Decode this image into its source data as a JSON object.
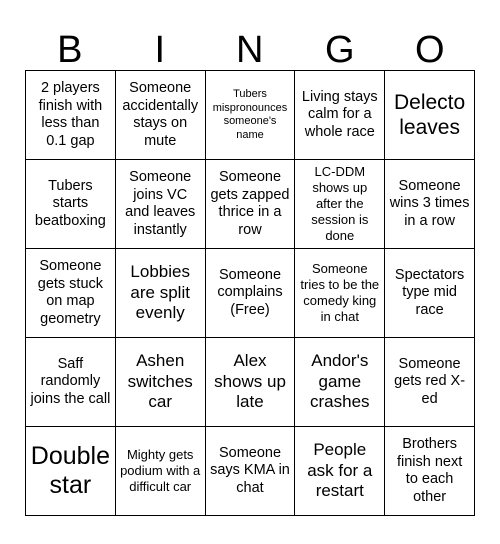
{
  "card": {
    "title": "BINGO",
    "header_letters": [
      "B",
      "I",
      "N",
      "G",
      "O"
    ],
    "grid_size": "5x5",
    "colors": {
      "background": "#ffffff",
      "text": "#000000",
      "border": "#000000"
    },
    "rows": [
      [
        {
          "text": "2 players finish with less than 0.1 gap",
          "size": "m",
          "marked": false
        },
        {
          "text": "Someone accidentally stays on mute",
          "size": "m",
          "marked": false
        },
        {
          "text": "Tubers mispronounces someone's name",
          "size": "xs",
          "marked": false
        },
        {
          "text": "Living stays calm for a whole race",
          "size": "m",
          "marked": false
        },
        {
          "text": "Delecto leaves",
          "size": "xl",
          "marked": false
        }
      ],
      [
        {
          "text": "Tubers starts beatboxing",
          "size": "m",
          "marked": false
        },
        {
          "text": "Someone joins VC and leaves instantly",
          "size": "m",
          "marked": false
        },
        {
          "text": "Someone gets zapped thrice in a row",
          "size": "m",
          "marked": false
        },
        {
          "text": "LC-DDM shows up after the session is done",
          "size": "s",
          "marked": false
        },
        {
          "text": "Someone wins 3 times in a row",
          "size": "m",
          "marked": false
        }
      ],
      [
        {
          "text": "Someone gets stuck on map geometry",
          "size": "m",
          "marked": false
        },
        {
          "text": "Lobbies are split evenly",
          "size": "l",
          "marked": false
        },
        {
          "text": "Someone complains (Free)",
          "size": "m",
          "marked": false
        },
        {
          "text": "Someone tries to be the comedy king in chat",
          "size": "s",
          "marked": false
        },
        {
          "text": "Spectators type mid race",
          "size": "m",
          "marked": false
        }
      ],
      [
        {
          "text": "Saff randomly joins the call",
          "size": "m",
          "marked": false
        },
        {
          "text": "Ashen switches car",
          "size": "l",
          "marked": false
        },
        {
          "text": "Alex shows up late",
          "size": "l",
          "marked": false
        },
        {
          "text": "Andor's game crashes",
          "size": "l",
          "marked": false
        },
        {
          "text": "Someone gets red X-ed",
          "size": "m",
          "marked": false
        }
      ],
      [
        {
          "text": "Double star",
          "size": "xxl",
          "marked": false
        },
        {
          "text": "Mighty gets podium with a difficult car",
          "size": "s",
          "marked": false
        },
        {
          "text": "Someone says KMA in chat",
          "size": "m",
          "marked": false
        },
        {
          "text": "People ask for a restart",
          "size": "l",
          "marked": false
        },
        {
          "text": "Brothers finish next to each other",
          "size": "m",
          "marked": false
        }
      ]
    ]
  }
}
